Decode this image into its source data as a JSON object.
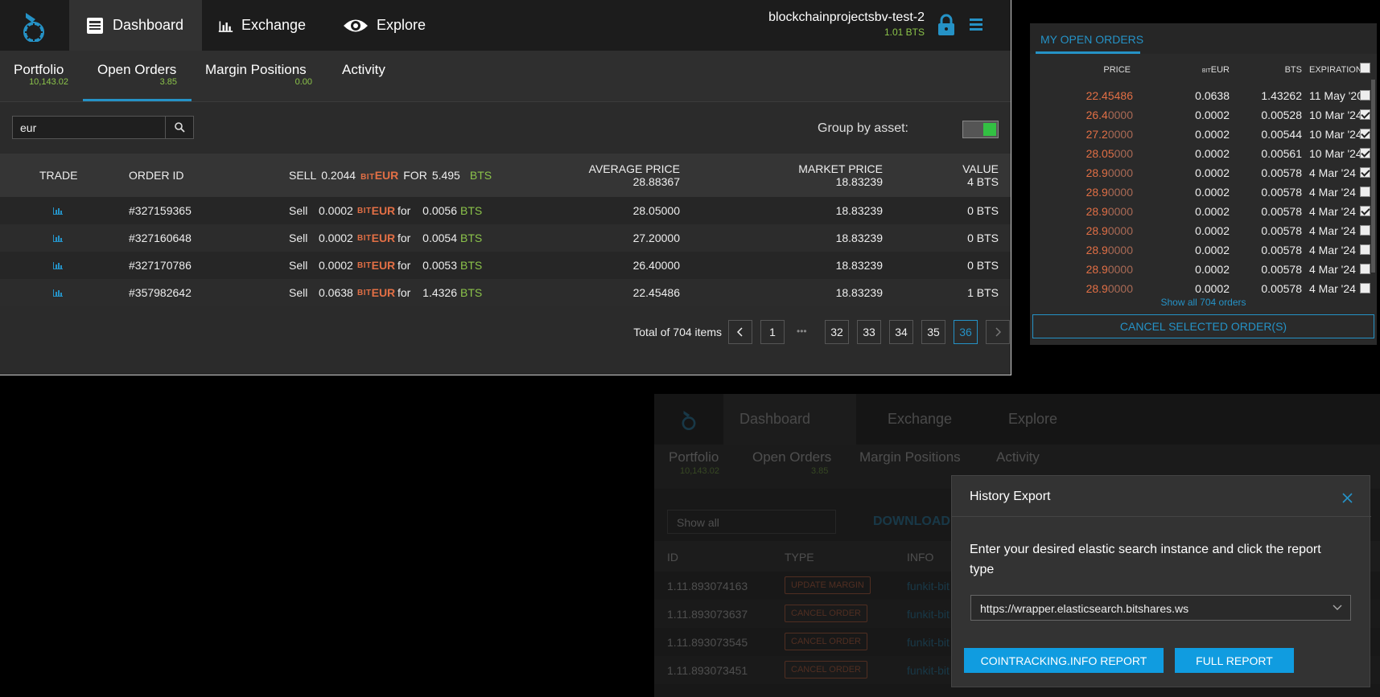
{
  "nav": {
    "tabs": [
      {
        "label": "Dashboard",
        "icon": "dashboard-icon"
      },
      {
        "label": "Exchange",
        "icon": "chart-icon"
      },
      {
        "label": "Explore",
        "icon": "eye-icon"
      }
    ],
    "account_name": "blockchainprojectsbv-test-2",
    "account_balance": "1.01 BTS"
  },
  "subnav": {
    "tabs": [
      {
        "label": "Portfolio",
        "sub": "10,143.02"
      },
      {
        "label": "Open Orders",
        "sub": "3.85"
      },
      {
        "label": "Margin Positions",
        "sub": "0.00"
      },
      {
        "label": "Activity",
        "sub": ""
      }
    ]
  },
  "filter": {
    "search_value": "eur",
    "group_label": "Group by asset:"
  },
  "table": {
    "headers": {
      "trade": "TRADE",
      "order_id": "ORDER ID",
      "sell": "SELL",
      "sell_amount": "0.2044",
      "bit": "BIT",
      "eur": "EUR",
      "for": "FOR",
      "for_amount": "5.495",
      "bts": "BTS",
      "avg_price": "AVERAGE PRICE",
      "avg_price_value": "28.88367",
      "market_price": "MARKET PRICE",
      "market_price_value": "18.83239",
      "value": "VALUE",
      "value_total": "4 BTS"
    },
    "rows": [
      {
        "order_id": "#327159365",
        "side": "Sell",
        "amount": "0.0002",
        "for": "for",
        "receive": "0.0056",
        "avg": "28.05000",
        "market": "18.83239",
        "value": "0 BTS"
      },
      {
        "order_id": "#327160648",
        "side": "Sell",
        "amount": "0.0002",
        "for": "for",
        "receive": "0.0054",
        "avg": "27.20000",
        "market": "18.83239",
        "value": "0 BTS"
      },
      {
        "order_id": "#327170786",
        "side": "Sell",
        "amount": "0.0002",
        "for": "for",
        "receive": "0.0053",
        "avg": "26.40000",
        "market": "18.83239",
        "value": "0 BTS"
      },
      {
        "order_id": "#357982642",
        "side": "Sell",
        "amount": "0.0638",
        "for": "for",
        "receive": "1.4326",
        "avg": "22.45486",
        "market": "18.83239",
        "value": "1 BTS"
      }
    ],
    "asset_bit": "BIT",
    "asset_eur": "EUR",
    "asset_bts": "BTS"
  },
  "pagination": {
    "total": "Total of 704 items",
    "pages": [
      "1",
      "32",
      "33",
      "34",
      "35",
      "36"
    ],
    "ellipsis": "•••",
    "current": "36"
  },
  "open_orders": {
    "title": "MY OPEN ORDERS",
    "col_price": "PRICE",
    "col_bit": "BIT",
    "col_eur": "EUR",
    "col_bts": "BTS",
    "col_exp": "EXPIRATION",
    "rows": [
      {
        "price_main": "22.45486",
        "price_dim": "",
        "eur": "0.0638",
        "bts": "1.43262",
        "exp": "11 May '20",
        "checked": false
      },
      {
        "price_main": "26.4",
        "price_dim": "0000",
        "eur": "0.0002",
        "bts": "0.00528",
        "exp": "10 Mar '24",
        "checked": true
      },
      {
        "price_main": "27.2",
        "price_dim": "0000",
        "eur": "0.0002",
        "bts": "0.00544",
        "exp": "10 Mar '24",
        "checked": true
      },
      {
        "price_main": "28.05",
        "price_dim": "000",
        "eur": "0.0002",
        "bts": "0.00561",
        "exp": "10 Mar '24",
        "checked": true
      },
      {
        "price_main": "28.9",
        "price_dim": "0000",
        "eur": "0.0002",
        "bts": "0.00578",
        "exp": "4 Mar '24",
        "checked": true
      },
      {
        "price_main": "28.9",
        "price_dim": "0000",
        "eur": "0.0002",
        "bts": "0.00578",
        "exp": "4 Mar '24",
        "checked": false
      },
      {
        "price_main": "28.9",
        "price_dim": "0000",
        "eur": "0.0002",
        "bts": "0.00578",
        "exp": "4 Mar '24",
        "checked": true
      },
      {
        "price_main": "28.9",
        "price_dim": "0000",
        "eur": "0.0002",
        "bts": "0.00578",
        "exp": "4 Mar '24",
        "checked": false
      },
      {
        "price_main": "28.9",
        "price_dim": "0000",
        "eur": "0.0002",
        "bts": "0.00578",
        "exp": "4 Mar '24",
        "checked": false
      },
      {
        "price_main": "28.9",
        "price_dim": "0000",
        "eur": "0.0002",
        "bts": "0.00578",
        "exp": "4 Mar '24",
        "checked": false
      },
      {
        "price_main": "28.9",
        "price_dim": "0000",
        "eur": "0.0002",
        "bts": "0.00578",
        "exp": "4 Mar '24",
        "checked": false
      }
    ],
    "show_all": "Show all 704 orders",
    "cancel": "CANCEL SELECTED ORDER(S)"
  },
  "background_window": {
    "tabs": [
      "Dashboard",
      "Exchange",
      "Explore"
    ],
    "subtabs": [
      {
        "label": "Portfolio",
        "sub": "10,143.02"
      },
      {
        "label": "Open Orders",
        "sub": "3.85"
      },
      {
        "label": "Margin Positions",
        "sub": ""
      },
      {
        "label": "Activity",
        "sub": ""
      }
    ],
    "filter_value": "Show all",
    "download": "DOWNLOAD",
    "headers": [
      "ID",
      "TYPE",
      "INFO"
    ],
    "rows": [
      {
        "id": "1.11.893074163",
        "type": "UPDATE MARGIN",
        "info": "funkit-bit"
      },
      {
        "id": "1.11.893073637",
        "type": "CANCEL ORDER",
        "info": "funkit-bit"
      },
      {
        "id": "1.11.893073545",
        "type": "CANCEL ORDER",
        "info": "funkit-bit"
      },
      {
        "id": "1.11.893073451",
        "type": "CANCEL ORDER",
        "info": "funkit-bit"
      }
    ]
  },
  "modal": {
    "title": "History Export",
    "text": "Enter your desired elastic search instance and click the report type",
    "select_value": "https://wrapper.elasticsearch.bitshares.ws",
    "btn_cointracking": "COINTRACKING.INFO REPORT",
    "btn_full": "FULL REPORT"
  },
  "colors": {
    "accent": "#2592c6",
    "sell": "#e26f45",
    "positive": "#8bc34a",
    "button": "#109ce0"
  }
}
